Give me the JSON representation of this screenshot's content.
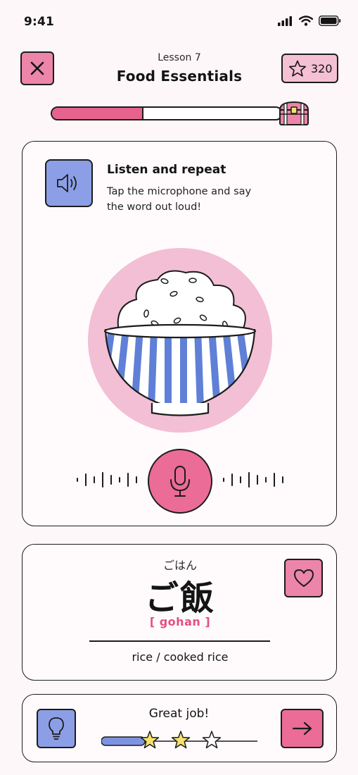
{
  "status_bar": {
    "time": "9:41"
  },
  "header": {
    "lesson_label": "Lesson 7",
    "title": "Food Essentials",
    "points": "320"
  },
  "progress": {
    "value": 0.4
  },
  "prompt": {
    "title": "Listen and repeat",
    "instruction": "Tap the microphone and say the word out loud!"
  },
  "word": {
    "furigana": "ごはん",
    "kanji": "ご飯",
    "romaji": "[ gohan ]",
    "meaning": "rice / cooked rice"
  },
  "feedback": {
    "message": "Great job!",
    "stars_earned": 2,
    "stars_total": 3,
    "meter": 0.28
  },
  "colors": {
    "pink": "#eb6c97",
    "light_pink": "#f5c0d3",
    "periwinkle": "#8c9fe6",
    "star": "#f7e26b"
  },
  "icons": [
    "close-icon",
    "star-icon",
    "treasure-chest-icon",
    "speaker-icon",
    "microphone-icon",
    "heart-icon",
    "lightbulb-icon",
    "arrow-right-icon"
  ]
}
